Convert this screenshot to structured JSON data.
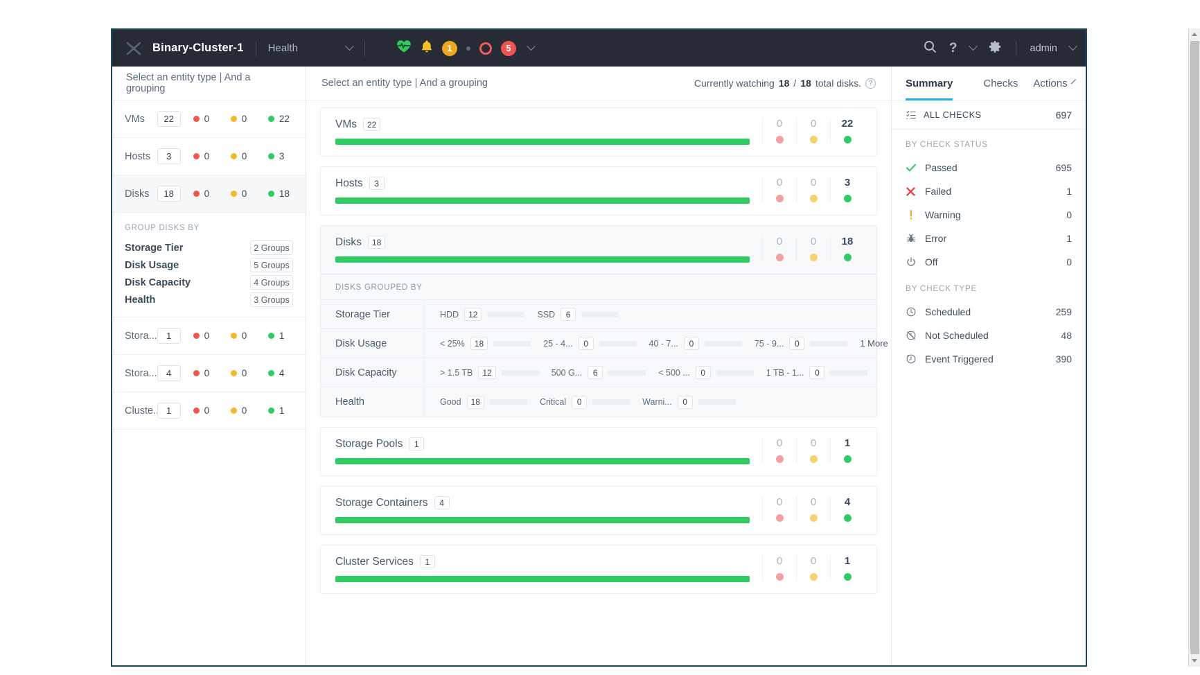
{
  "topbar": {
    "logo": "x-logo-icon",
    "cluster_name": "Binary-Cluster-1",
    "nav_label": "Health",
    "health_icon": "heartbeat-icon",
    "bell_icon": "bell-icon",
    "amber_badge": "1",
    "ring_icon": "circle-outline-icon",
    "red_badge": "5",
    "search_icon": "search-icon",
    "help_icon": "question-mark-icon",
    "settings_icon": "gear-icon",
    "user_name": "admin"
  },
  "left_pane": {
    "header": "Select an entity type | And a grouping",
    "entities": [
      {
        "name": "VMs",
        "total": "22",
        "red": "0",
        "amber": "0",
        "green": "22",
        "selected": false
      },
      {
        "name": "Hosts",
        "total": "3",
        "red": "0",
        "amber": "0",
        "green": "3",
        "selected": false
      },
      {
        "name": "Disks",
        "total": "18",
        "red": "0",
        "amber": "0",
        "green": "18",
        "selected": true
      }
    ],
    "group_title": "GROUP DISKS BY",
    "groupings": [
      {
        "label": "Storage Tier",
        "groups": "2 Groups"
      },
      {
        "label": "Disk Usage",
        "groups": "5 Groups"
      },
      {
        "label": "Disk Capacity",
        "groups": "4 Groups"
      },
      {
        "label": "Health",
        "groups": "3 Groups"
      }
    ],
    "entities_after": [
      {
        "name": "Stora...",
        "total": "1",
        "red": "0",
        "amber": "0",
        "green": "1"
      },
      {
        "name": "Stora...",
        "total": "4",
        "red": "0",
        "amber": "0",
        "green": "4"
      },
      {
        "name": "Cluste...",
        "total": "1",
        "red": "0",
        "amber": "0",
        "green": "1"
      }
    ]
  },
  "center_pane": {
    "header": "Select an entity type | And a grouping",
    "watch_prefix": "Currently watching",
    "watch_current": "18",
    "watch_sep": "/",
    "watch_total": "18",
    "watch_suffix": "total disks.",
    "help_icon": "question-circle-icon",
    "cards": [
      {
        "title": "VMs",
        "count": "22",
        "fill_pct": 100,
        "red": "0",
        "amber": "0",
        "green": "22",
        "active": false
      },
      {
        "title": "Hosts",
        "count": "3",
        "fill_pct": 100,
        "red": "0",
        "amber": "0",
        "green": "3",
        "active": false
      },
      {
        "title": "Disks",
        "count": "18",
        "fill_pct": 100,
        "red": "0",
        "amber": "0",
        "green": "18",
        "active": true
      }
    ],
    "grouped_title": "DISKS GROUPED BY",
    "grouped_rows": [
      {
        "label": "Storage Tier",
        "cells": [
          {
            "label": "HDD",
            "value": "12",
            "fill_pct": 100
          },
          {
            "label": "SSD",
            "value": "6",
            "fill_pct": 100
          }
        ],
        "more": ""
      },
      {
        "label": "Disk Usage",
        "cells": [
          {
            "label": "< 25%",
            "value": "18",
            "fill_pct": 100
          },
          {
            "label": "25 - 4...",
            "value": "0",
            "fill_pct": 0
          },
          {
            "label": "40 - 7...",
            "value": "0",
            "fill_pct": 0
          },
          {
            "label": "75 - 9...",
            "value": "0",
            "fill_pct": 0
          }
        ],
        "more": "1 More"
      },
      {
        "label": "Disk Capacity",
        "cells": [
          {
            "label": "> 1.5 TB",
            "value": "12",
            "fill_pct": 100
          },
          {
            "label": "500 G...",
            "value": "6",
            "fill_pct": 100
          },
          {
            "label": "< 500 ...",
            "value": "0",
            "fill_pct": 0
          },
          {
            "label": "1 TB - 1...",
            "value": "0",
            "fill_pct": 0
          }
        ],
        "more": ""
      },
      {
        "label": "Health",
        "cells": [
          {
            "label": "Good",
            "value": "18",
            "fill_pct": 100
          },
          {
            "label": "Critical",
            "value": "0",
            "fill_pct": 0
          },
          {
            "label": "Warni...",
            "value": "0",
            "fill_pct": 0
          }
        ],
        "more": ""
      }
    ],
    "cards_after": [
      {
        "title": "Storage Pools",
        "count": "1",
        "fill_pct": 100,
        "red": "0",
        "amber": "0",
        "green": "1"
      },
      {
        "title": "Storage Containers",
        "count": "4",
        "fill_pct": 100,
        "red": "0",
        "amber": "0",
        "green": "4"
      },
      {
        "title": "Cluster Services",
        "count": "1",
        "fill_pct": 100,
        "red": "0",
        "amber": "0",
        "green": "1"
      }
    ]
  },
  "right_pane": {
    "tabs": [
      {
        "label": "Summary",
        "active": true
      },
      {
        "label": "Checks",
        "active": false
      },
      {
        "label": "Actions",
        "active": false
      }
    ],
    "all_checks_label": "ALL CHECKS",
    "all_checks_value": "697",
    "status_section_title": "BY CHECK STATUS",
    "status_rows": [
      {
        "icon": "check-icon",
        "label": "Passed",
        "value": "695"
      },
      {
        "icon": "x-icon",
        "label": "Failed",
        "value": "1"
      },
      {
        "icon": "warning-icon",
        "label": "Warning",
        "value": "0"
      },
      {
        "icon": "bug-icon",
        "label": "Error",
        "value": "1"
      },
      {
        "icon": "power-icon",
        "label": "Off",
        "value": "0"
      }
    ],
    "type_section_title": "BY CHECK TYPE",
    "type_rows": [
      {
        "icon": "clock-icon",
        "label": "Scheduled",
        "value": "259"
      },
      {
        "icon": "clock-off-icon",
        "label": "Not Scheduled",
        "value": "48"
      },
      {
        "icon": "clock-event-icon",
        "label": "Event Triggered",
        "value": "390"
      }
    ]
  },
  "colors": {
    "green": "#2ecc63",
    "red": "#f2564d",
    "amber": "#f5b722",
    "accent": "#22a7f0",
    "topbar_bg": "#262b35"
  }
}
